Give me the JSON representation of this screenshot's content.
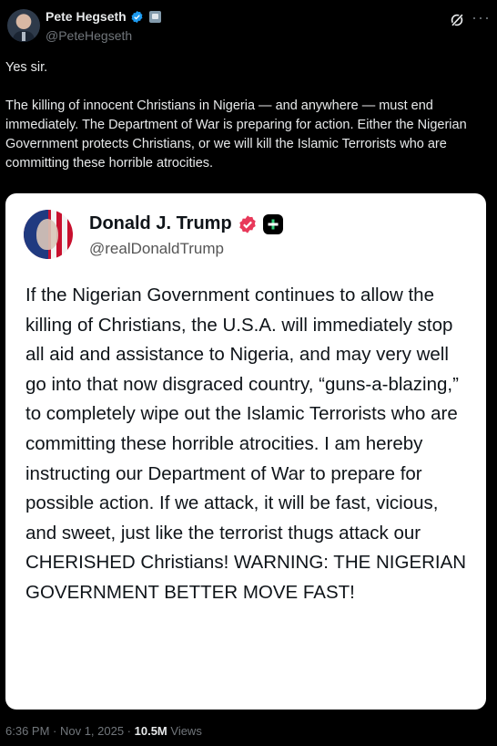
{
  "author": {
    "name": "Pete Hegseth",
    "handle": "@PeteHegseth"
  },
  "tweet": {
    "line1": "Yes sir.",
    "line2": "The killing of innocent Christians in Nigeria — and anywhere — must end immediately. The Department of War is preparing for action. Either the Nigerian Government protects Christians, or we will kill the Islamic Terrorists who are committing these horrible atrocities."
  },
  "quote": {
    "name": "Donald J. Trump",
    "handle": "@realDonaldTrump",
    "text": "If the Nigerian Government continues to allow the killing of Christians, the U.S.A. will immediately stop all aid and assistance to Nigeria, and may very well go into that now disgraced country, “guns-a-blazing,” to completely wipe out the Islamic Terrorists who are committing these horrible atrocities. I am hereby instructing our Department of War to prepare for possible action. If we attack, it will be fast, vicious, and sweet, just like the terrorist thugs attack our CHERISHED Christians! WARNING: THE NIGERIAN GOVERNMENT BETTER MOVE FAST!"
  },
  "meta": {
    "timestamp": "6:36 PM · Nov 1, 2025 · ",
    "views_count": "10.5M",
    "views_label": " Views"
  },
  "colors": {
    "background": "#000000",
    "x_verified": "#1d9bf0",
    "truth_verified": "#e8395a",
    "text_primary": "#e7e9ea",
    "text_secondary": "#71767b"
  },
  "icons": {
    "verified": "verified-badge-icon",
    "government": "government-badge-icon",
    "grok": "grok-icon",
    "more": "more-options-icon",
    "truth_verified": "truth-verified-badge-icon",
    "plus": "plus-badge-icon"
  }
}
